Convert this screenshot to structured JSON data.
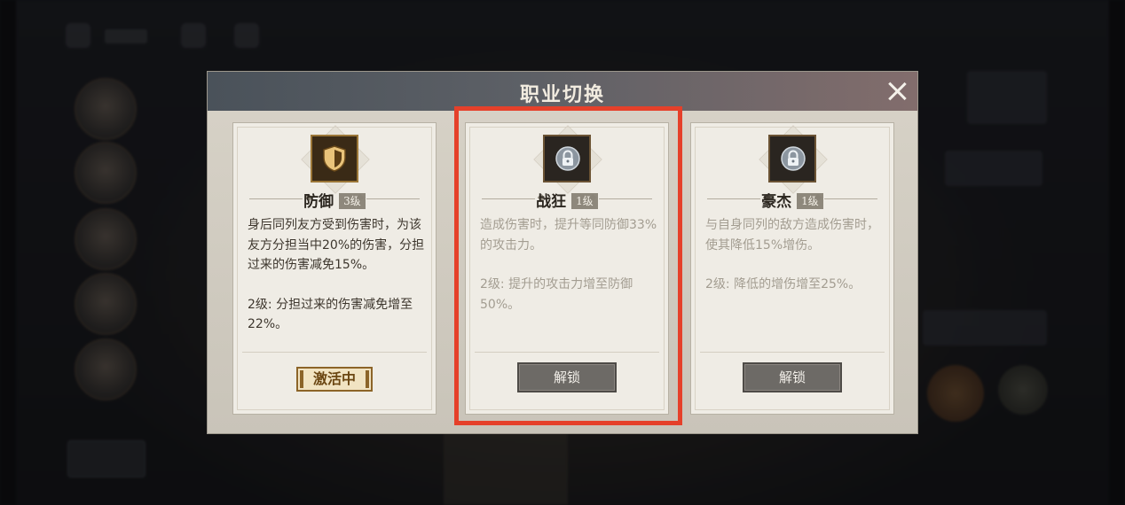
{
  "modal": {
    "title": "职业切换"
  },
  "cards": [
    {
      "name": "防御",
      "level": "3级",
      "icon": "shield-icon",
      "state": "active",
      "desc1": "身后同列友方受到伤害时，为该友方分担当中20%的伤害，分担过来的伤害减免15%。",
      "desc2": "2级: 分担过来的伤害减免增至22%。",
      "status_label": "激活中"
    },
    {
      "name": "战狂",
      "level": "1级",
      "icon": "lock-icon",
      "state": "locked",
      "desc1": "造成伤害时，提升等同防御33%的攻击力。",
      "desc2": "2级: 提升的攻击力增至防御50%。",
      "button_label": "解锁"
    },
    {
      "name": "豪杰",
      "level": "1级",
      "icon": "lock-icon",
      "state": "locked",
      "desc1": "与自身同列的敌方造成伤害时，使其降低15%增伤。",
      "desc2": "2级: 降低的增伤增至25%。",
      "button_label": "解锁"
    }
  ],
  "colors": {
    "highlight": "#e5402a",
    "active_gold": "#8c6428"
  }
}
